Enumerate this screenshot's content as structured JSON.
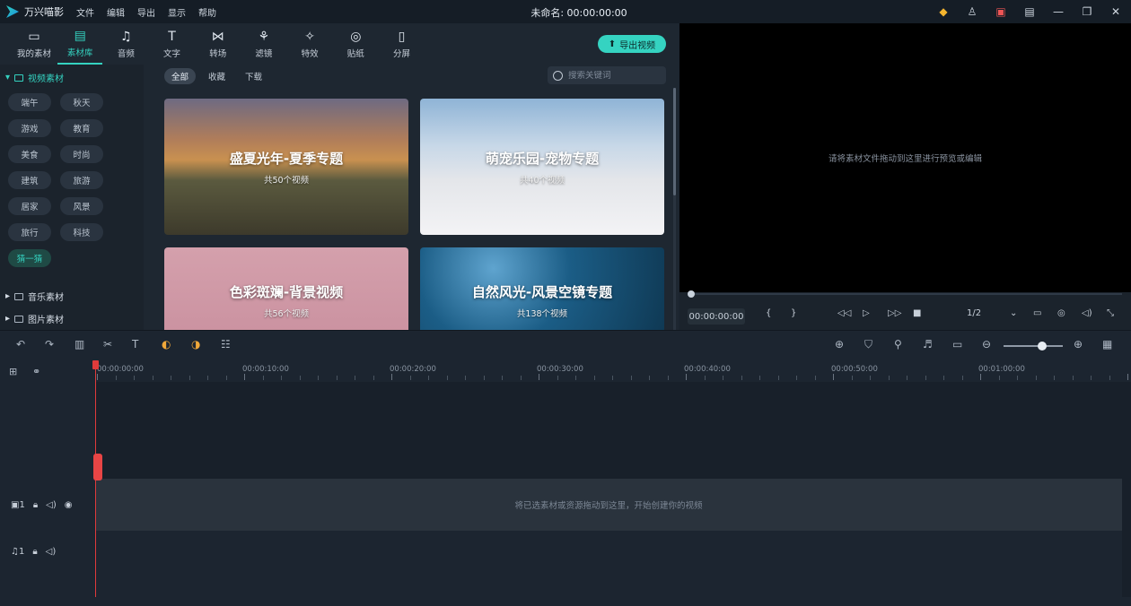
{
  "app": {
    "name": "万兴喵影",
    "title": "未命名: 00:00:00:00",
    "menu": [
      "文件",
      "编辑",
      "导出",
      "显示",
      "帮助"
    ]
  },
  "toolbar": {
    "tools": [
      {
        "label": "我的素材",
        "icon": "folder-icon"
      },
      {
        "label": "素材库",
        "icon": "library-icon"
      },
      {
        "label": "音频",
        "icon": "music-icon"
      },
      {
        "label": "文字",
        "icon": "text-icon"
      },
      {
        "label": "转场",
        "icon": "transition-icon"
      },
      {
        "label": "滤镜",
        "icon": "filter-icon"
      },
      {
        "label": "特效",
        "icon": "effects-icon"
      },
      {
        "label": "贴纸",
        "icon": "sticker-icon"
      },
      {
        "label": "分屏",
        "icon": "splitscreen-icon"
      }
    ],
    "active_index": 1,
    "export_label": "导出视频"
  },
  "sidebar": {
    "video_section": "视频素材",
    "tags": [
      "端午",
      "秋天",
      "游戏",
      "教育",
      "美食",
      "时尚",
      "建筑",
      "旅游",
      "居家",
      "风景",
      "旅行",
      "科技",
      "猜一猜"
    ],
    "active_tag": "猜一猜",
    "music_section": "音乐素材",
    "image_section": "图片素材"
  },
  "filters": {
    "items": [
      "全部",
      "收藏",
      "下载"
    ],
    "active": "全部"
  },
  "search": {
    "placeholder": "搜索关键词"
  },
  "cards": [
    {
      "title": "盛夏光年-夏季专题",
      "subtitle": "共50个视频"
    },
    {
      "title": "萌宠乐园-宠物专题",
      "subtitle": "共40个视频"
    },
    {
      "title": "色彩斑斓-背景视频",
      "subtitle": "共56个视频"
    },
    {
      "title": "自然风光-风景空镜专题",
      "subtitle": "共138个视频"
    }
  ],
  "preview": {
    "hint": "请将素材文件拖动到这里进行预览或编辑",
    "timecode": "00:00:00:00",
    "bracket_in": "{",
    "bracket_out": "}",
    "ratio": "1/2"
  },
  "timeline": {
    "ruler": [
      "00:00:00:00",
      "00:00:10:00",
      "00:00:20:00",
      "00:00:30:00",
      "00:00:40:00",
      "00:00:50:00",
      "00:01:00:00"
    ],
    "empty_hint": "将已选素材或资源拖动到这里，开始创建你的视频",
    "video_track": "1",
    "audio_track": "1"
  }
}
